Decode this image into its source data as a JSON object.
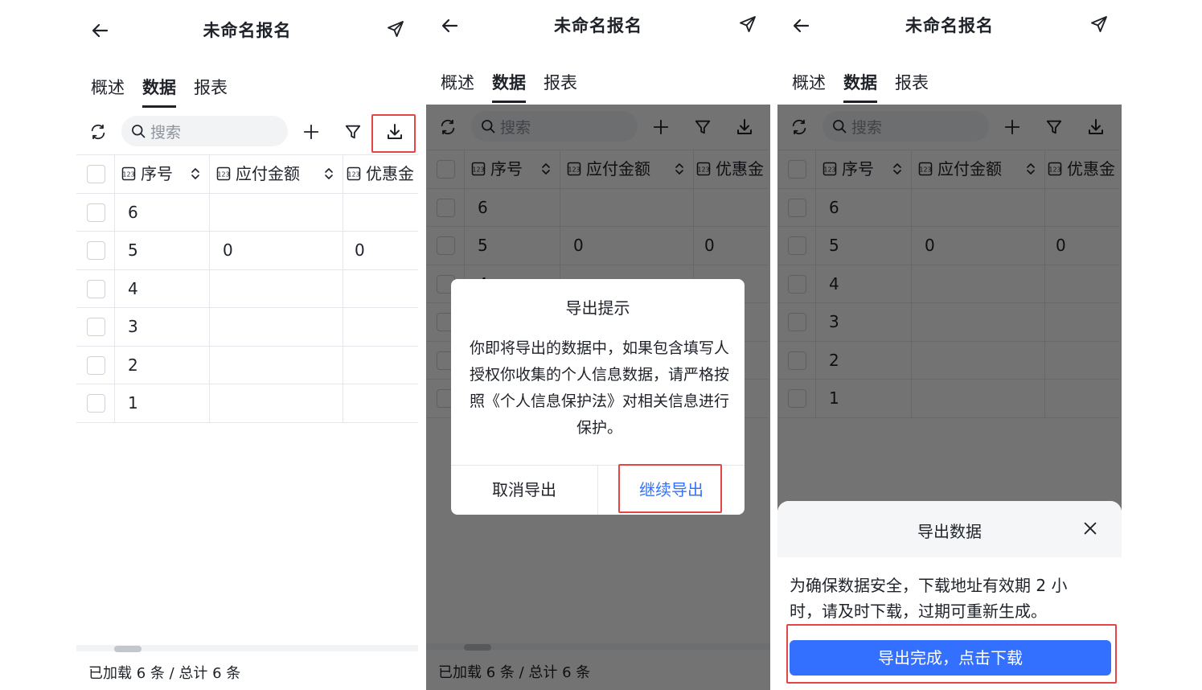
{
  "app": {
    "title": "未命名报名",
    "tabs": [
      {
        "label": "概述",
        "active": false
      },
      {
        "label": "数据",
        "active": true
      },
      {
        "label": "报表",
        "active": false
      }
    ],
    "search_placeholder": "搜索",
    "icons": [
      "back-arrow-icon",
      "send-icon",
      "refresh-icon",
      "search-icon",
      "plus-icon",
      "filter-icon",
      "download-icon"
    ]
  },
  "table": {
    "columns": [
      "序号",
      "应付金额",
      "优惠金"
    ],
    "rows": [
      {
        "seq": "6",
        "amount": "",
        "discount": ""
      },
      {
        "seq": "5",
        "amount": "0",
        "discount": "0"
      },
      {
        "seq": "4",
        "amount": "",
        "discount": ""
      },
      {
        "seq": "3",
        "amount": "",
        "discount": ""
      },
      {
        "seq": "2",
        "amount": "",
        "discount": ""
      },
      {
        "seq": "1",
        "amount": "",
        "discount": ""
      }
    ]
  },
  "footer": {
    "status": "已加载 6 条 / 总计 6 条"
  },
  "export_dialog": {
    "title": "导出提示",
    "message": "你即将导出的数据中，如果包含填写人授权你收集的个人信息数据，请严格按照《个人信息保护法》对相关信息进行保护。",
    "cancel_label": "取消导出",
    "continue_label": "继续导出"
  },
  "export_sheet": {
    "title": "导出数据",
    "message": "为确保数据安全，下载地址有效期 2 小时，请及时下载，过期可重新生成。",
    "button_label": "导出完成，点击下载"
  },
  "colors": {
    "accent": "#3370ff",
    "highlight": "#e54545",
    "text": "#1f2329",
    "placeholder": "#8f959e",
    "border": "#e5e6eb"
  }
}
